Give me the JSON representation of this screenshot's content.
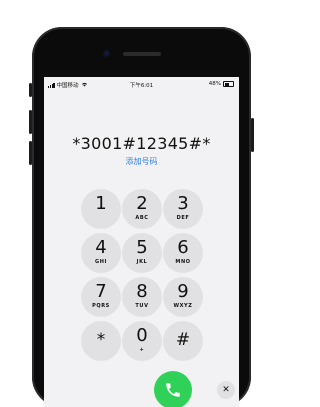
{
  "status_bar": {
    "carrier": "中国移动",
    "time": "下午6:01",
    "battery": "48%"
  },
  "dialer": {
    "number": "*3001#12345#*",
    "add_number_label": "添加号码",
    "keys": [
      {
        "digit": "1",
        "letters": ""
      },
      {
        "digit": "2",
        "letters": "ABC"
      },
      {
        "digit": "3",
        "letters": "DEF"
      },
      {
        "digit": "4",
        "letters": "GHI"
      },
      {
        "digit": "5",
        "letters": "JKL"
      },
      {
        "digit": "6",
        "letters": "MNO"
      },
      {
        "digit": "7",
        "letters": "PQRS"
      },
      {
        "digit": "8",
        "letters": "TUV"
      },
      {
        "digit": "9",
        "letters": "WXYZ"
      },
      {
        "digit": "*",
        "letters": ""
      },
      {
        "digit": "0",
        "letters": "+"
      },
      {
        "digit": "#",
        "letters": ""
      }
    ],
    "call_icon": "phone-icon",
    "delete_icon": "backspace-icon",
    "delete_symbol": "✕"
  },
  "colors": {
    "accent": "#2f7fe6",
    "call_green": "#30d158",
    "key_bg": "#e1e1e4",
    "screen_bg": "#f2f2f4"
  }
}
